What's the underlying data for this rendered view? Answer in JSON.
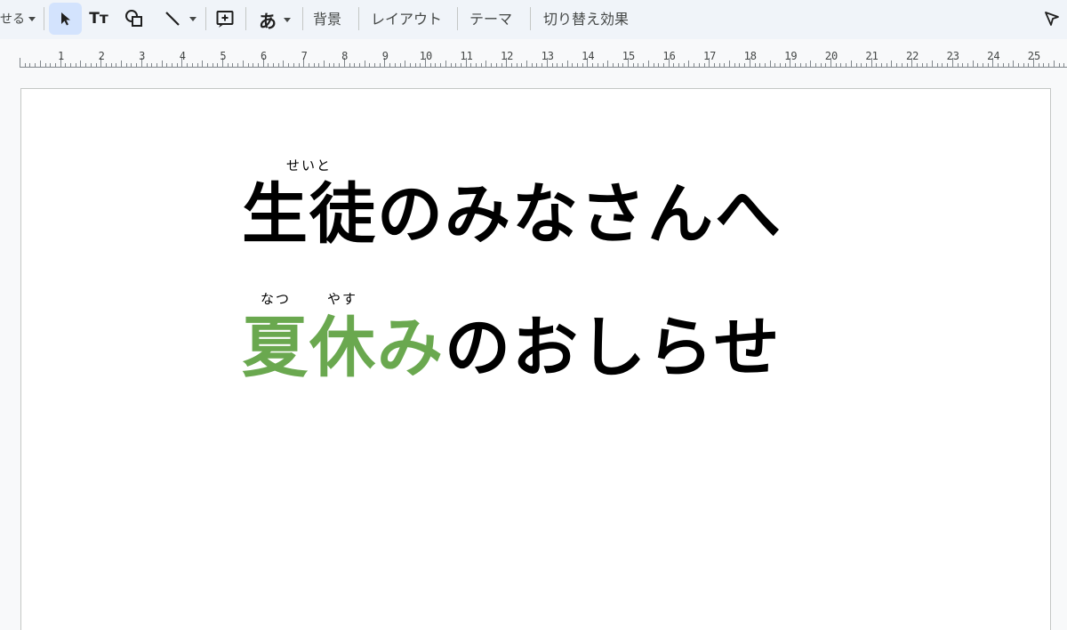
{
  "toolbar": {
    "cut_label": "せる",
    "text_style_icon": "Tт",
    "input_tool_char": "あ",
    "background_label": "背景",
    "layout_label": "レイアウト",
    "theme_label": "テーマ",
    "transition_label": "切り替え効果"
  },
  "ruler": {
    "numbers": [
      "1",
      "2",
      "3",
      "4",
      "5",
      "6",
      "7",
      "8",
      "9",
      "10",
      "11",
      "12",
      "13",
      "14",
      "15",
      "16",
      "17",
      "18",
      "19",
      "20",
      "21",
      "22",
      "23",
      "24",
      "25"
    ]
  },
  "slide": {
    "line1": {
      "ruby": "せいと",
      "text": "生徒のみなさんへ"
    },
    "line2": {
      "ruby_natsu": "なつ",
      "ruby_yasu": "やす",
      "green_text": "夏休み",
      "rest_text": "のおしらせ"
    }
  },
  "colors": {
    "toolbar_bg": "#f0f4f9",
    "selected_tool_bg": "#d3e3fd",
    "accent_green": "#6aa84f"
  }
}
